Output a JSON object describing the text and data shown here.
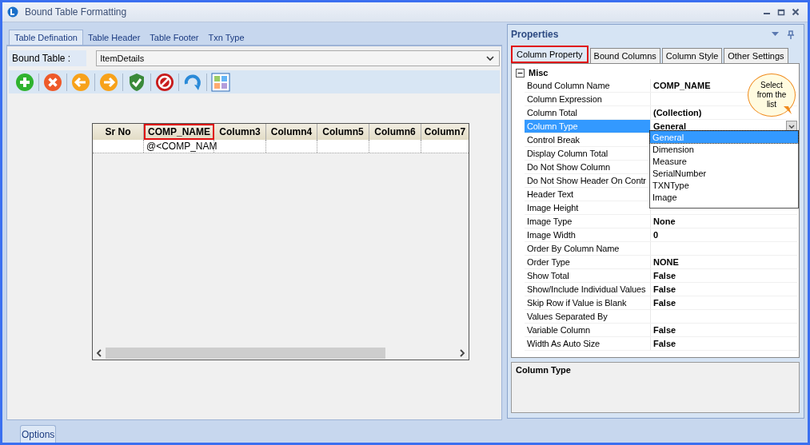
{
  "window": {
    "title": "Bound Table Formatting"
  },
  "tabs": [
    {
      "label": "Table Defination",
      "selected": true
    },
    {
      "label": "Table Header",
      "selected": false
    },
    {
      "label": "Table Footer",
      "selected": false
    },
    {
      "label": "Txn Type",
      "selected": false
    }
  ],
  "bound_table": {
    "label": "Bound Table :",
    "value": "ItemDetails"
  },
  "grid": {
    "columns": [
      {
        "label": "Sr No",
        "selected": false
      },
      {
        "label": "COMP_NAME",
        "selected": true
      },
      {
        "label": "Column3",
        "selected": false
      },
      {
        "label": "Column4",
        "selected": false
      },
      {
        "label": "Column5",
        "selected": false
      },
      {
        "label": "Column6",
        "selected": false
      },
      {
        "label": "Column7",
        "selected": false
      }
    ],
    "rows": [
      [
        "",
        "@<COMP_NAM",
        "",
        "",
        "",
        "",
        ""
      ]
    ]
  },
  "properties": {
    "title": "Properties",
    "tabs": [
      {
        "label": "Column Property",
        "selected": true
      },
      {
        "label": "Bound Columns",
        "selected": false
      },
      {
        "label": "Column Style",
        "selected": false
      },
      {
        "label": "Other Settings",
        "selected": false
      }
    ],
    "category": {
      "label": "Misc",
      "expanded": true
    },
    "rows": [
      {
        "name": "Bound Column Name",
        "value": "COMP_NAME",
        "selected": false
      },
      {
        "name": "Column Expression",
        "selected": false
      },
      {
        "name": "Column Total",
        "value": "(Collection)",
        "selected": false
      },
      {
        "name": "Column Type",
        "value": "General",
        "selected": true
      },
      {
        "name": "Control Break",
        "selected": false
      },
      {
        "name": "Display Column Total",
        "selected": false
      },
      {
        "name": "Do Not Show Column",
        "selected": false
      },
      {
        "name": "Do Not Show Header On Contr",
        "selected": false
      },
      {
        "name": "Header Text",
        "selected": false
      },
      {
        "name": "Image Height",
        "selected": false
      },
      {
        "name": "Image Type",
        "value": "None",
        "selected": false
      },
      {
        "name": "Image Width",
        "value": "0",
        "selected": false
      },
      {
        "name": "Order By Column Name",
        "selected": false
      },
      {
        "name": "Order Type",
        "value": "NONE",
        "selected": false
      },
      {
        "name": "Show Total",
        "value": "False",
        "selected": false
      },
      {
        "name": "Show/Include Individual Values",
        "value": "False",
        "selected": false
      },
      {
        "name": "Skip Row if Value is Blank",
        "value": "False",
        "selected": false
      },
      {
        "name": "Values Separated By",
        "selected": false
      },
      {
        "name": "Variable Column",
        "value": "False",
        "selected": false
      },
      {
        "name": "Width As Auto Size",
        "value": "False",
        "selected": false
      }
    ],
    "dropdown": {
      "options": [
        {
          "label": "General",
          "selected": true
        },
        {
          "label": "Dimension",
          "selected": false
        },
        {
          "label": "Measure",
          "selected": false
        },
        {
          "label": "SerialNumber",
          "selected": false
        },
        {
          "label": "TXNType",
          "selected": false
        },
        {
          "label": "Image",
          "selected": false
        }
      ]
    },
    "callout": "Select from the list",
    "description_title": "Column Type"
  },
  "options_button": "Options"
}
